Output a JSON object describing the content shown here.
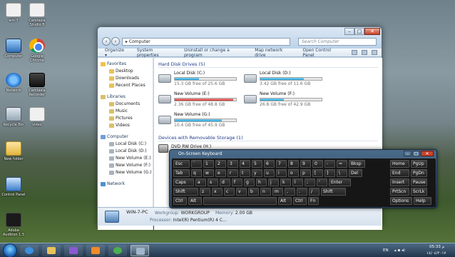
{
  "desktop": {
    "icons": [
      {
        "label": "win 7",
        "icon": "folder-doc-icon"
      },
      {
        "label": "Camtasia Studio 8",
        "icon": "camtasia-icon"
      },
      {
        "label": "Computer",
        "icon": "computer-icon"
      },
      {
        "label": "Google Chrome",
        "icon": "chrome-icon"
      },
      {
        "label": "Network",
        "icon": "network-icon"
      },
      {
        "label": "Camtasia Recorder",
        "icon": "recorder-icon"
      },
      {
        "label": "Recycle Bin",
        "icon": "recycle-bin-icon"
      },
      {
        "label": "video",
        "icon": "video-file-icon"
      },
      {
        "label": "New folder",
        "icon": "folder-icon"
      },
      {
        "label": "Control Panel",
        "icon": "control-panel-icon"
      },
      {
        "label": "Adobe Audition 1.5",
        "icon": "audition-icon"
      }
    ]
  },
  "explorer": {
    "address": "Computer",
    "search_placeholder": "Search Computer",
    "toolbar": [
      "Organize ▾",
      "System properties",
      "Uninstall or change a program",
      "Map network drive",
      "Open Control Panel"
    ],
    "nav": {
      "favorites": {
        "label": "Favorites",
        "items": [
          "Desktop",
          "Downloads",
          "Recent Places"
        ]
      },
      "libraries": {
        "label": "Libraries",
        "items": [
          "Documents",
          "Music",
          "Pictures",
          "Videos"
        ]
      },
      "computer": {
        "label": "Computer",
        "items": [
          "Local Disk (C:)",
          "Local Disk (D:)",
          "New Volume (E:)",
          "New Volume (F:)",
          "New Volume (G:)"
        ]
      },
      "network": {
        "label": "Network"
      }
    },
    "hard_disk_header": "Hard Disk Drives (5)",
    "drives": [
      {
        "name": "Local Disk (C:)",
        "free": "15.3 GB free of 25.6 GB",
        "used_fraction": 0.4,
        "status": "normal"
      },
      {
        "name": "Local Disk (D:)",
        "free": "3.42 GB free of 11.6 GB",
        "used_fraction": 0.71,
        "status": "normal"
      },
      {
        "name": "New Volume (E:)",
        "free": "2.36 GB free of 48.8 GB",
        "used_fraction": 0.95,
        "status": "low"
      },
      {
        "name": "New Volume (F:)",
        "free": "26.8 GB free of 42.9 GB",
        "used_fraction": 0.38,
        "status": "normal"
      },
      {
        "name": "New Volume (G:)",
        "free": "10.4 GB free of 45.9 GB",
        "used_fraction": 0.77,
        "status": "normal"
      }
    ],
    "removable_header": "Devices with Removable Storage (1)",
    "dvd": {
      "name": "DVD RW Drive (H:)"
    },
    "details": {
      "name": "WIN-7-PC",
      "workgroup_label": "Workgroup:",
      "workgroup": "WORKGROUP",
      "memory_label": "Memory:",
      "memory": "2.00 GB",
      "processor_label": "Processor:",
      "processor": "Intel(R) Pentium(R) 4 C..."
    },
    "colors": {
      "bar_normal": "#2aa1d5",
      "bar_low": "#d32828"
    }
  },
  "osk": {
    "title": "On-Screen Keyboard",
    "rows": [
      [
        "Esc",
        "`",
        "1",
        "2",
        "3",
        "4",
        "5",
        "6",
        "7",
        "8",
        "9",
        "0",
        "-",
        "=",
        "Bksp",
        "Home",
        "PgUp"
      ],
      [
        "Tab",
        "q",
        "w",
        "e",
        "r",
        "t",
        "y",
        "u",
        "i",
        "o",
        "p",
        "[",
        "]",
        "\\",
        "Del",
        "End",
        "PgDn"
      ],
      [
        "Caps",
        "a",
        "s",
        "d",
        "f",
        "g",
        "h",
        "j",
        "k",
        "l",
        ";",
        "'",
        "Enter",
        "Insert",
        "Pause"
      ],
      [
        "Shift",
        "z",
        "x",
        "c",
        "v",
        "b",
        "n",
        "m",
        ",",
        ".",
        "/",
        "Shift",
        "PrtScn",
        "ScrLk"
      ],
      [
        "Ctrl",
        "Alt",
        "",
        "Alt",
        "Ctrl",
        "Fn",
        "Options",
        "Help"
      ]
    ]
  },
  "taskbar": {
    "apps": [
      "ie-icon",
      "folder-icon",
      "media-icon",
      "media-player-icon",
      "chrome-icon",
      "osk-icon"
    ],
    "language": "EN",
    "time": "05:33 م",
    "date": "١٤/٠٤/٢٠١٧"
  }
}
